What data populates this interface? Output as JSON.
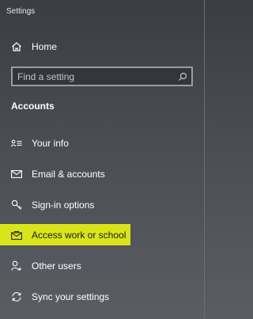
{
  "window": {
    "title": "Settings"
  },
  "nav": {
    "home_label": "Home",
    "search_placeholder": "Find a setting",
    "section_title": "Accounts",
    "items": [
      {
        "label": "Your info",
        "icon": "contact-card-icon"
      },
      {
        "label": "Email & accounts",
        "icon": "mail-icon"
      },
      {
        "label": "Sign-in options",
        "icon": "key-icon"
      },
      {
        "label": "Access work or school",
        "icon": "briefcase-mail-icon",
        "selected": true
      },
      {
        "label": "Other users",
        "icon": "person-add-icon"
      },
      {
        "label": "Sync your settings",
        "icon": "sync-icon"
      }
    ]
  },
  "colors": {
    "highlight": "#e6f01e",
    "text": "#ffffff"
  }
}
